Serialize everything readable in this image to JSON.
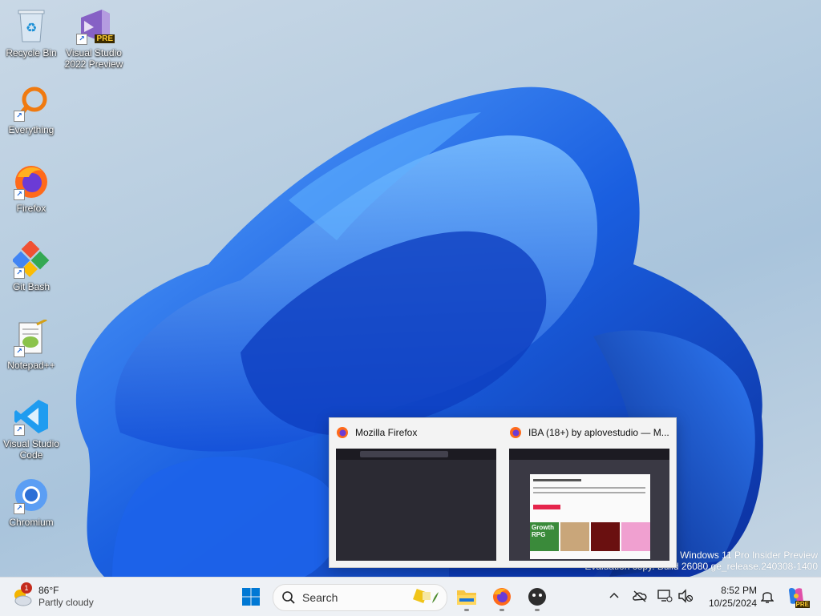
{
  "desktop": {
    "icons": [
      {
        "label": "Recycle Bin",
        "icon": "recycle-bin-icon"
      },
      {
        "label": "Visual Studio\n2022 Preview",
        "icon": "visual-studio-preview-icon",
        "badge": "PRE"
      },
      {
        "label": "Everything",
        "icon": "everything-search-icon"
      },
      {
        "label": "Firefox",
        "icon": "firefox-icon"
      },
      {
        "label": "Git Bash",
        "icon": "git-bash-icon"
      },
      {
        "label": "Notepad++",
        "icon": "notepad-plus-plus-icon"
      },
      {
        "label": "Visual Studio\nCode",
        "icon": "vscode-icon"
      },
      {
        "label": "Chromium",
        "icon": "chromium-icon"
      }
    ],
    "watermark": {
      "line1": "Windows 11 Pro Insider Preview",
      "line2": "Evaluation copy. Build 26080.ge_release.240308-1400"
    }
  },
  "preview": {
    "windows": [
      {
        "title": "Mozilla Firefox"
      },
      {
        "title": "IBA (18+) by aplovestudio — M..."
      }
    ],
    "thumb2": {
      "cards": [
        "Growth RPG",
        "",
        "",
        ""
      ]
    }
  },
  "taskbar": {
    "weather": {
      "temp": "86°F",
      "condition": "Partly cloudy",
      "badge": "1"
    },
    "search_placeholder": "Search",
    "clock": {
      "time": "8:52 PM",
      "date": "10/25/2024"
    },
    "copilot_badge": "PRE"
  },
  "colors": {
    "taskbar_bg": "#eef1f5",
    "bloom_blue": "#1a5fe0",
    "windows_blue": "#0078d4"
  }
}
